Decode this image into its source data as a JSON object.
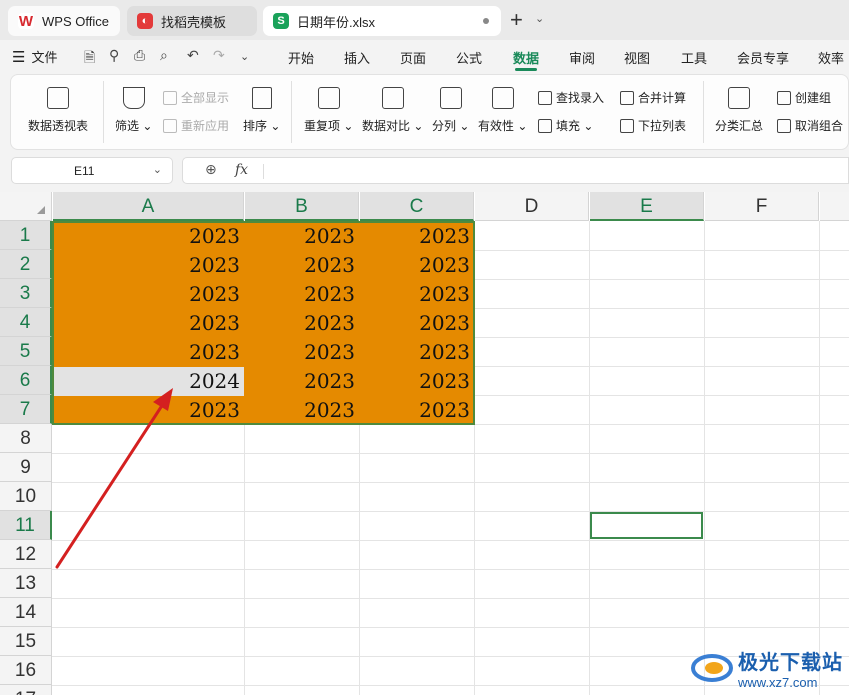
{
  "tabs": [
    {
      "label": "WPS Office",
      "icon": "wps-logo-icon"
    },
    {
      "label": "找稻壳模板",
      "icon": "docer-icon"
    },
    {
      "label": "日期年份.xlsx",
      "icon": "spreadsheet-icon"
    }
  ],
  "menu": {
    "file_label": "文件",
    "items": [
      "开始",
      "插入",
      "页面",
      "公式",
      "数据",
      "审阅",
      "视图",
      "工具",
      "会员专享",
      "效率"
    ],
    "active": "数据"
  },
  "ribbon": {
    "pivot": "数据透视表",
    "filter": "筛选",
    "show_all": "全部显示",
    "reapply": "重新应用",
    "sort": "排序",
    "duplicates": "重复项",
    "compare": "数据对比",
    "split": "分列",
    "validity": "有效性",
    "lookup_entry": "查找录入",
    "fill": "填充",
    "merge_calc": "合并计算",
    "dropdown": "下拉列表",
    "subtotal": "分类汇总",
    "group": "创建组",
    "ungroup": "取消组合"
  },
  "formula_bar": {
    "cell_ref": "E11",
    "fx": "fx",
    "value": ""
  },
  "columns": [
    "A",
    "B",
    "C",
    "D",
    "E",
    "F"
  ],
  "rows": [
    "1",
    "2",
    "3",
    "4",
    "5",
    "6",
    "7",
    "8",
    "9",
    "10",
    "11",
    "12",
    "13",
    "14",
    "15",
    "16",
    "17"
  ],
  "cells": [
    [
      "2023",
      "2023",
      "2023"
    ],
    [
      "2023",
      "2023",
      "2023"
    ],
    [
      "2023",
      "2023",
      "2023"
    ],
    [
      "2023",
      "2023",
      "2023"
    ],
    [
      "2023",
      "2023",
      "2023"
    ],
    [
      "2024",
      "2023",
      "2023"
    ],
    [
      "2023",
      "2023",
      "2023"
    ]
  ],
  "colors": {
    "fill": "#e58a00",
    "accent": "#1a8a5a",
    "arrow": "#d42020"
  },
  "watermark": {
    "title": "极光下载站",
    "url": "www.xz7.com"
  }
}
